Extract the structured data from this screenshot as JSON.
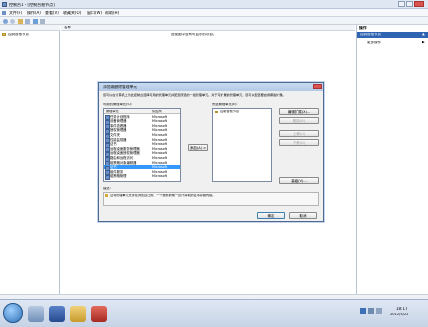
{
  "window": {
    "title": "控制台1 - [控制台根节点]",
    "menu": [
      "文件(F)",
      "操作(A)",
      "查看(V)",
      "收藏夹(O)",
      "窗口(W)",
      "帮助(H)"
    ]
  },
  "tree": {
    "header": "",
    "root": "控制台根节点"
  },
  "main": {
    "column_header": "名称",
    "empty_text": "此视图中没有可显示的项目。"
  },
  "actions": {
    "header": "操作",
    "section": "控制台根节点",
    "more": "更多操作"
  },
  "dialog": {
    "title": "添加或删除管理单元",
    "description": "您可以在计算机上为此控制台选择可用的管理单元并配置所选的一组管理单元。对于可扩展的管理单元，您可以配置要启用哪些扩展。",
    "available_label": "可用的管理单元(S):",
    "col_name": "管理单元",
    "col_vendor": "供应商",
    "snapins": [
      {
        "name": "任务计划程序",
        "vendor": "Microsoft"
      },
      {
        "name": "设备管理器",
        "vendor": "Microsoft"
      },
      {
        "name": "事件查看器",
        "vendor": "Microsoft"
      },
      {
        "name": "授权管理器",
        "vendor": "Microsoft"
      },
      {
        "name": "文件夹",
        "vendor": "Microsoft"
      },
      {
        "name": "性能监视器",
        "vendor": "Microsoft"
      },
      {
        "name": "证书",
        "vendor": "Microsoft"
      },
      {
        "name": "远程桌面服务管理器",
        "vendor": "Microsoft"
      },
      {
        "name": "远程桌面授权管理器",
        "vendor": "Microsoft"
      },
      {
        "name": "路由和远程访问",
        "vendor": "Microsoft"
      },
      {
        "name": "组策略对象编辑器",
        "vendor": "Microsoft"
      },
      {
        "name": "证书",
        "vendor": "Microsoft"
      },
      {
        "name": "组件服务",
        "vendor": "Microsoft"
      },
      {
        "name": "组策略管理",
        "vendor": "Microsoft"
      }
    ],
    "selected_index": 11,
    "add_button": "添加(A) >",
    "selected_label": "所选管理单元(E):",
    "selected_items": [
      "控制台根节点"
    ],
    "side_buttons": [
      "编辑扩展(X)...",
      "删除(R)",
      "上移(U)",
      "下移(D)"
    ],
    "advanced_button": "高级(V)...",
    "desc_label": "描述:",
    "desc_text": "证书管理单元允许您浏览自己的、一个服务的或一台计算机的证书存储内容。",
    "ok_button": "确定",
    "cancel_button": "取消"
  },
  "taskbar": {
    "clock_time": "18:17",
    "clock_date": "2012/5/22"
  },
  "colors": {
    "accent": "#3399ff",
    "action_header": "#2f64b3",
    "titlebar": "#dfe7f2"
  }
}
